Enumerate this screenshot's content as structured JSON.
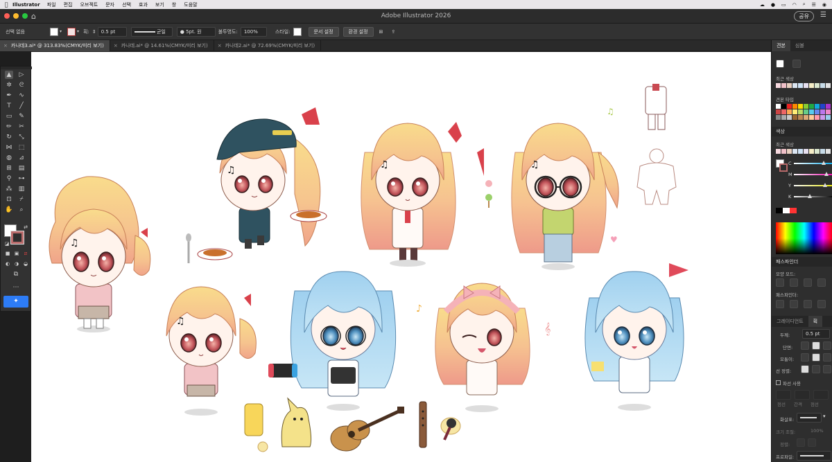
{
  "menubar": {
    "app_name": "Illustrator",
    "items": [
      "파일",
      "편집",
      "오브젝트",
      "문자",
      "선택",
      "효과",
      "보기",
      "창",
      "도움말"
    ]
  },
  "window": {
    "title": "Adobe Illustrator 2026",
    "share_label": "공유"
  },
  "control": {
    "selection_label": "선택 없음",
    "stroke_label": "획:",
    "stroke_value": "0.5 pt",
    "profile_label": "균일",
    "brush_label": "5pt. 원",
    "opacity_label": "불투명도:",
    "opacity_value": "100%",
    "style_label": "스타일:",
    "doc_setup_label": "문서 설정",
    "prefs_label": "환경 설정"
  },
  "tabs": [
    {
      "label": "카나데3.ai* @ 313.83%(CMYK/미리 보기)"
    },
    {
      "label": "카나데.ai* @ 14.61%(CMYK/미리 보기)"
    },
    {
      "label": "카나데2.ai* @ 72.69%(CMYK/미리 보기)"
    }
  ],
  "panels": {
    "swatches_tab": "견본",
    "symbols_tab": "심볼",
    "recent_colors": "최근 색상",
    "swatch_types": "견본 타입",
    "color_head": "색상",
    "recent_colors_2": "최근 색상",
    "channels": [
      "C",
      "M",
      "Y",
      "K"
    ],
    "pathfinder_head": "패스파인더",
    "shape_modes": "모양 모드:",
    "pathfinders": "패스파인더:",
    "gradient_tab": "그레이디언트",
    "stroke_tab": "획",
    "weight_label": "두께:",
    "weight_value": "0.5 pt",
    "cap_label": "단면:",
    "corner_label": "모퉁이:",
    "align_label": "선 정렬:",
    "dashed_label": "파선 사용",
    "dash_labels": [
      "점선",
      "간격",
      "점선"
    ],
    "arrowhead_label": "화살표:",
    "scale_label": "크기 조절:",
    "scale_value": "100%",
    "align2_label": "정렬:",
    "profile_label": "프로파일:"
  },
  "colors": {
    "accent": "#2d7cf6",
    "hair": "#f7dc8a",
    "hair_blue": "#a9d6ef",
    "skin": "#fff3ec"
  }
}
